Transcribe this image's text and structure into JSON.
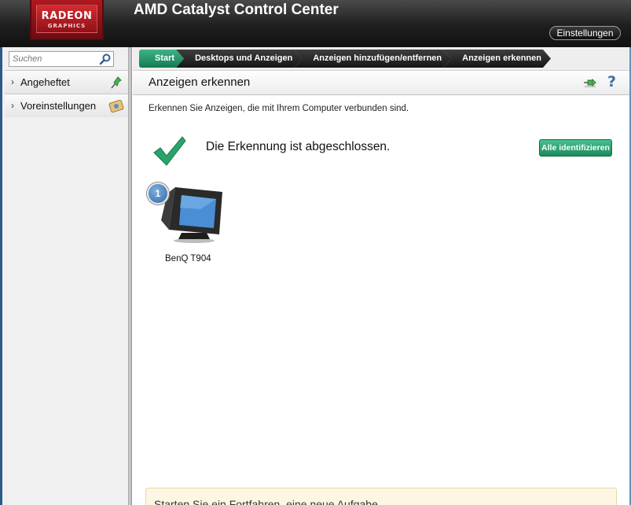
{
  "header": {
    "logo_line1": "RADEON",
    "logo_line2": "GRAPHICS",
    "title": "AMD Catalyst Control Center",
    "settings_label": "Einstellungen"
  },
  "sidebar": {
    "search_placeholder": "Suchen",
    "items": [
      {
        "label": "Angeheftet",
        "icon": "pin-icon"
      },
      {
        "label": "Voreinstellungen",
        "icon": "presets-icon"
      }
    ]
  },
  "breadcrumbs": [
    "Start",
    "Desktops und Anzeigen",
    "Anzeigen hinzufügen/entfernen",
    "Anzeigen erkennen"
  ],
  "page": {
    "title": "Anzeigen erkennen",
    "help": "?",
    "description": "Erkennen Sie Anzeigen, die mit Ihrem Computer verbunden sind.",
    "status": "Die Erkennung ist abgeschlossen.",
    "identify_all": "Alle identifizieren"
  },
  "displays": [
    {
      "number": "1",
      "name": "BenQ T904"
    }
  ],
  "tips": {
    "text": "Starten Sie ein Fortfahren, eine neue Aufgabe..."
  },
  "colors": {
    "accent_green": "#1b8a5b",
    "header_dark": "#111111",
    "logo_red": "#b0171f"
  }
}
